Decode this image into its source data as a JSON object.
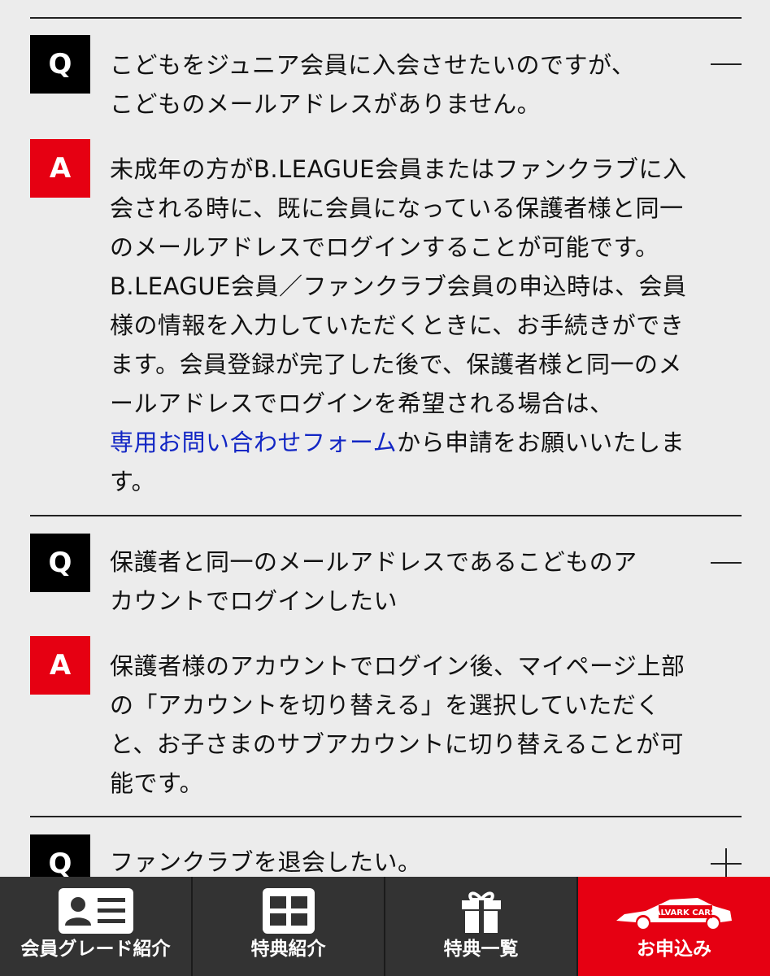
{
  "faq": {
    "items": [
      {
        "q_badge": "Q",
        "question": "こどもをジュニア会員に入会させたいのですが、\nこどものメールアドレスがありません。",
        "a_badge": "A",
        "answer_part1": "未成年の方がB.LEAGUE会員またはファンクラブに入\n会される時に、既に会員になっている保護者様と同一\nのメールアドレスでログインすることが可能です。\nB.LEAGUE会員／ファンクラブ会員の申込時は、会員\n様の情報を入力していただくときに、お手続きができ\nます。会員登録が完了した後で、保護者様と同一のメ\nールアドレスでログインを希望される場合は、\n",
        "answer_link": "専用お問い合わせフォーム",
        "answer_part2": "から申請をお願いいたしま\nす。",
        "toggle_icon": "minus-icon"
      },
      {
        "q_badge": "Q",
        "question": "保護者と同一のメールアドレスであるこどものア\nカウントでログインしたい",
        "a_badge": "A",
        "answer": "保護者様のアカウントでログイン後、マイページ上部\nの「アカウントを切り替える」を選択していただく\nと、お子さまのサブアカウントに切り替えることが可\n能です。",
        "toggle_icon": "minus-icon"
      },
      {
        "q_badge": "Q",
        "question": "ファンクラブを退会したい。",
        "toggle_icon": "plus-icon"
      }
    ]
  },
  "nav": {
    "items": [
      {
        "label": "会員グレード紹介",
        "icon": "member-card-icon"
      },
      {
        "label": "特典紹介",
        "icon": "grid-icon"
      },
      {
        "label": "特典一覧",
        "icon": "gift-icon"
      },
      {
        "label": "お申込み",
        "icon": "alvark-car-logo",
        "logo_text": "ALVARK CARS"
      }
    ]
  },
  "colors": {
    "background": "#ececec",
    "accent_red": "#e60012",
    "nav_dark": "#333333",
    "link_blue": "#1226c4"
  }
}
